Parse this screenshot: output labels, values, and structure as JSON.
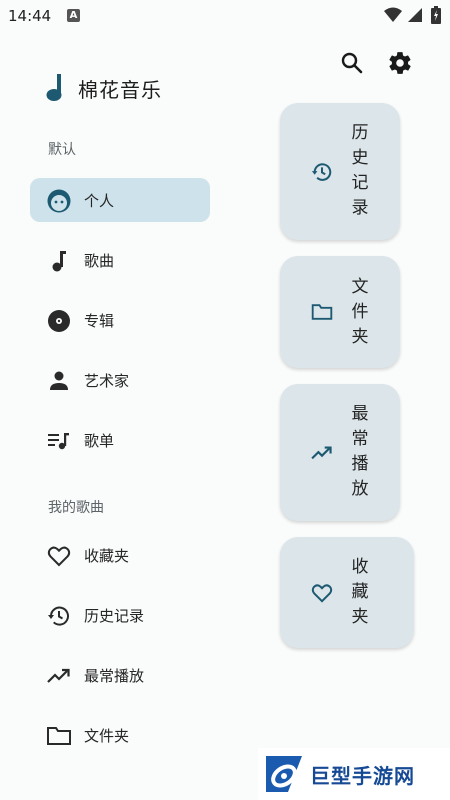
{
  "status_bar": {
    "time": "14:44",
    "notification_letter": "A"
  },
  "app": {
    "title": "棉花音乐"
  },
  "sections": {
    "default_label": "默认",
    "my_songs_label": "我的歌曲"
  },
  "nav_default": [
    {
      "label": "个人",
      "icon": "face-icon",
      "active": true
    },
    {
      "label": "歌曲",
      "icon": "music-note-icon"
    },
    {
      "label": "专辑",
      "icon": "album-disc-icon"
    },
    {
      "label": "艺术家",
      "icon": "person-icon"
    },
    {
      "label": "歌单",
      "icon": "playlist-icon"
    }
  ],
  "nav_my_songs": [
    {
      "label": "收藏夹",
      "icon": "heart-icon"
    },
    {
      "label": "历史记录",
      "icon": "history-icon"
    },
    {
      "label": "最常播放",
      "icon": "trending-up-icon"
    },
    {
      "label": "文件夹",
      "icon": "folder-icon"
    }
  ],
  "cards": [
    {
      "label": "历史记录",
      "icon": "history-icon"
    },
    {
      "label": "文件夹",
      "icon": "folder-icon"
    },
    {
      "label": "最常播放",
      "icon": "trending-up-icon"
    },
    {
      "label": "收藏夹",
      "icon": "heart-icon"
    }
  ],
  "colors": {
    "accent": "#1d5a72",
    "active_bg": "#cde2ea",
    "card_bg": "#dce6ea"
  },
  "watermark": {
    "text": "巨型手游网"
  }
}
